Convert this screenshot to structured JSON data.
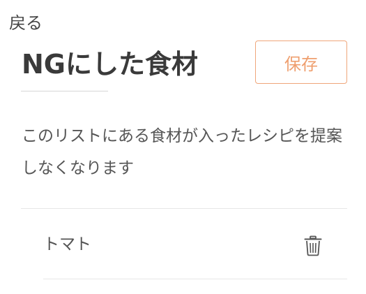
{
  "header": {
    "back_label": "戻る",
    "title": "NGにした食材",
    "save_label": "保存"
  },
  "description": "このリストにある食材が入ったレシピを提案しなくなります",
  "ng_items": [
    {
      "name": "トマト",
      "action_icon": "trash-icon"
    }
  ],
  "colors": {
    "accent": "#ef9f6f",
    "text": "#444444",
    "divider": "#e6e6e6"
  }
}
